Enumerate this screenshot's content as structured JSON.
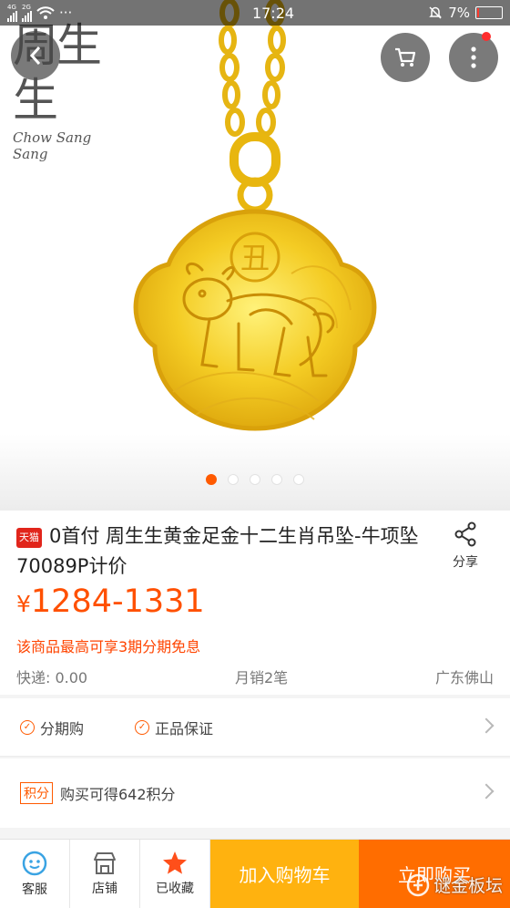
{
  "status_bar": {
    "network_1": "4G",
    "network_2": "2G",
    "more": "···",
    "time": "17:24",
    "battery_percent": "7%",
    "battery_level": 0.07
  },
  "hero": {
    "brand_cn": "周生生",
    "brand_en": "Chow Sang Sang",
    "pendant_glyph": "丑",
    "carousel_count": 5,
    "carousel_active": 0
  },
  "product": {
    "store_badge": "天猫",
    "title": "0首付 周生生黄金足金十二生肖吊坠-牛项坠70089P计价",
    "share_label": "分享",
    "price": "1284-1331",
    "currency": "¥",
    "promo": "该商品最高可享3期分期免息",
    "shipping": "快递: 0.00",
    "monthly_sales": "月销2笔",
    "location": "广东佛山"
  },
  "services": {
    "items": [
      "分期购",
      "正品保证"
    ]
  },
  "points": {
    "tag": "积分",
    "text": "购买可得642积分"
  },
  "bottom_bar": {
    "service_label": "客服",
    "store_label": "店铺",
    "favorite_label": "已收藏",
    "add_cart_label": "加入购物车",
    "buy_now_label": "立即购买",
    "watermark": "谜金板坛"
  },
  "colors": {
    "accent": "#ff5000",
    "add_cart": "#ffb20f",
    "buy_now": "#ff6d00",
    "gold": "#f5cf2a"
  }
}
